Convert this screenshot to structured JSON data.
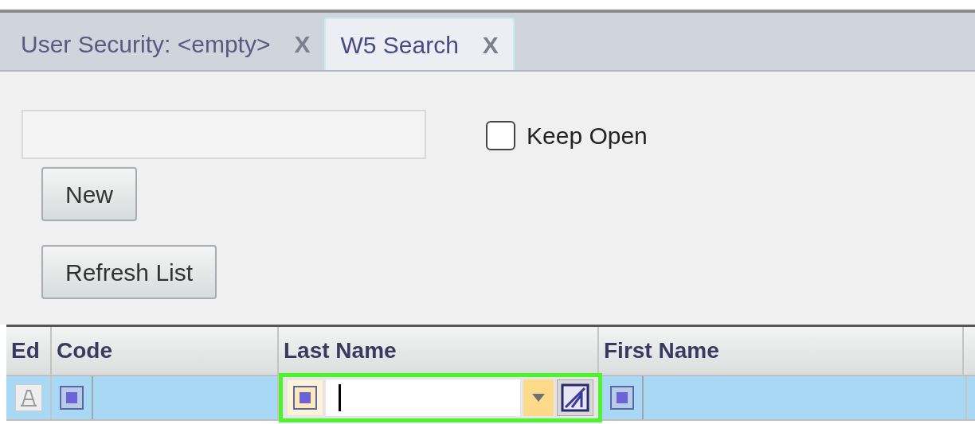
{
  "tabs": [
    {
      "label": "User Security: <empty>",
      "close": "X",
      "selected": false
    },
    {
      "label": "W5 Search",
      "close": "X",
      "selected": true
    }
  ],
  "keep_open": {
    "label": "Keep Open",
    "checked": false
  },
  "buttons": [
    "New",
    "Refresh List"
  ],
  "table": {
    "columns": [
      "Ed",
      "Code",
      "Last Name",
      "First Name"
    ],
    "rows": [
      {
        "selected": true,
        "cells": [
          {
            "kind": "edit"
          },
          {
            "kind": "check"
          },
          {
            "kind": "editor",
            "focused": true
          },
          {
            "kind": "check"
          }
        ]
      }
    ]
  }
}
